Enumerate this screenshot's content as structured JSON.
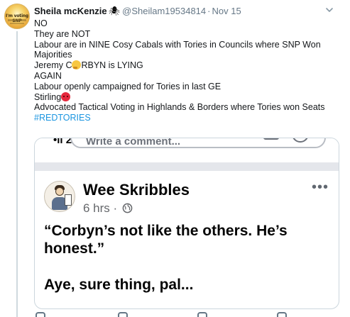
{
  "tweet": {
    "author_name": "Sheila mcKenzie",
    "author_emoji": "🕷",
    "handle": "@Sheilam19534814",
    "separator": "·",
    "date": "Nov 15",
    "avatar_text": "I'm voting SNP",
    "lines": [
      "NO",
      "They are NOT",
      "Labour are in NINE Cosy Cabals with Tories in Councils where SNP Won",
      "Majorities"
    ],
    "line_jeremy_a": "Jeremy C",
    "line_jeremy_b": "RBYN is LYING",
    "line_again": "AGAIN",
    "line_campaigned": "Labour openly campaigned for Tories in last GE",
    "line_stirling": "Stirling",
    "line_tactical": "Advocated Tactical Voting in Highlands & Borders where Tories won Seats",
    "hashtag": "#REDTORIES",
    "emoji_names": [
      "thinking-face-emoji",
      "angry-face-emoji"
    ]
  },
  "embedded_post": {
    "comment_placeholder": "Write a comment...",
    "author": "Wee Skribbles",
    "time": "6 hrs",
    "separator": "·",
    "more": "•••",
    "text_line1": "“Corbyn’s not like the others. He’s",
    "text_line2": "honest.”",
    "text_line3": "Aye, sure thing, pal..."
  },
  "colors": {
    "hashtag": "#1b95e0",
    "meta_gray": "#657786",
    "border": "#ccd6dd"
  }
}
